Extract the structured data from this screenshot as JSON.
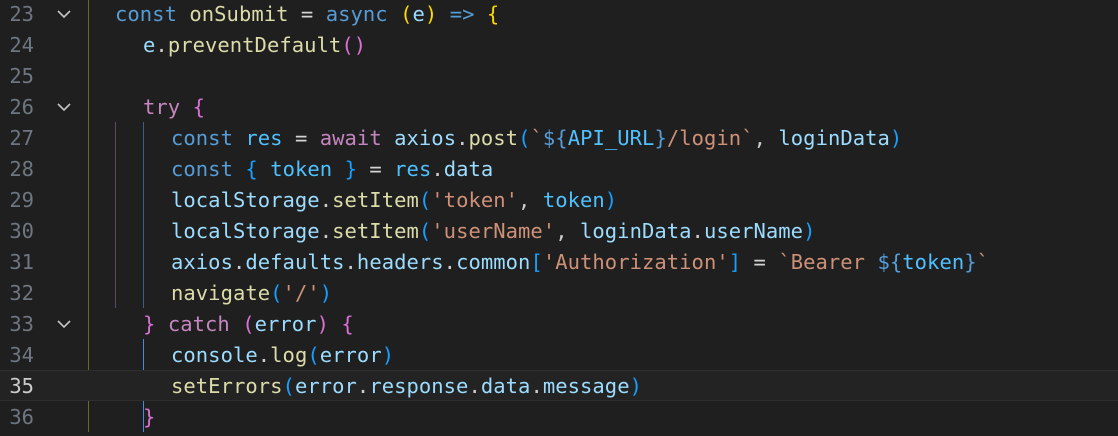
{
  "editor": {
    "lines": [
      {
        "num": "23",
        "fold": true,
        "indent": 1,
        "tokens": [
          {
            "t": "const",
            "c": "kw"
          },
          {
            "t": " ",
            "c": "punc"
          },
          {
            "t": "onSubmit",
            "c": "fnname"
          },
          {
            "t": " = ",
            "c": "op"
          },
          {
            "t": "async",
            "c": "kw"
          },
          {
            "t": " ",
            "c": "punc"
          },
          {
            "t": "(",
            "c": "b1"
          },
          {
            "t": "e",
            "c": "var"
          },
          {
            "t": ")",
            "c": "b1"
          },
          {
            "t": " => ",
            "c": "kw"
          },
          {
            "t": "{",
            "c": "b1"
          }
        ]
      },
      {
        "num": "24",
        "fold": false,
        "indent": 2,
        "tokens": [
          {
            "t": "e",
            "c": "var"
          },
          {
            "t": ".",
            "c": "punc"
          },
          {
            "t": "preventDefault",
            "c": "fnname"
          },
          {
            "t": "()",
            "c": "b2"
          }
        ]
      },
      {
        "num": "25",
        "fold": false,
        "indent": 2,
        "tokens": []
      },
      {
        "num": "26",
        "fold": true,
        "indent": 2,
        "tokens": [
          {
            "t": "try",
            "c": "ctrl"
          },
          {
            "t": " ",
            "c": "punc"
          },
          {
            "t": "{",
            "c": "b2"
          }
        ]
      },
      {
        "num": "27",
        "fold": false,
        "indent": 3,
        "tokens": [
          {
            "t": "const",
            "c": "kw"
          },
          {
            "t": " ",
            "c": "punc"
          },
          {
            "t": "res",
            "c": "const"
          },
          {
            "t": " = ",
            "c": "op"
          },
          {
            "t": "await",
            "c": "ctrl"
          },
          {
            "t": " ",
            "c": "punc"
          },
          {
            "t": "axios",
            "c": "var"
          },
          {
            "t": ".",
            "c": "punc"
          },
          {
            "t": "post",
            "c": "fnname"
          },
          {
            "t": "(",
            "c": "b3"
          },
          {
            "t": "`",
            "c": "str"
          },
          {
            "t": "${",
            "c": "kw"
          },
          {
            "t": "API_URL",
            "c": "const"
          },
          {
            "t": "}",
            "c": "kw"
          },
          {
            "t": "/login`",
            "c": "str"
          },
          {
            "t": ", ",
            "c": "punc"
          },
          {
            "t": "loginData",
            "c": "var"
          },
          {
            "t": ")",
            "c": "b3"
          }
        ]
      },
      {
        "num": "28",
        "fold": false,
        "indent": 3,
        "tokens": [
          {
            "t": "const",
            "c": "kw"
          },
          {
            "t": " ",
            "c": "punc"
          },
          {
            "t": "{",
            "c": "b3"
          },
          {
            "t": " ",
            "c": "punc"
          },
          {
            "t": "token",
            "c": "const"
          },
          {
            "t": " ",
            "c": "punc"
          },
          {
            "t": "}",
            "c": "b3"
          },
          {
            "t": " = ",
            "c": "op"
          },
          {
            "t": "res",
            "c": "const"
          },
          {
            "t": ".",
            "c": "punc"
          },
          {
            "t": "data",
            "c": "var"
          }
        ]
      },
      {
        "num": "29",
        "fold": false,
        "indent": 3,
        "tokens": [
          {
            "t": "localStorage",
            "c": "var"
          },
          {
            "t": ".",
            "c": "punc"
          },
          {
            "t": "setItem",
            "c": "fnname"
          },
          {
            "t": "(",
            "c": "b3"
          },
          {
            "t": "'token'",
            "c": "str"
          },
          {
            "t": ", ",
            "c": "punc"
          },
          {
            "t": "token",
            "c": "const"
          },
          {
            "t": ")",
            "c": "b3"
          }
        ]
      },
      {
        "num": "30",
        "fold": false,
        "indent": 3,
        "tokens": [
          {
            "t": "localStorage",
            "c": "var"
          },
          {
            "t": ".",
            "c": "punc"
          },
          {
            "t": "setItem",
            "c": "fnname"
          },
          {
            "t": "(",
            "c": "b3"
          },
          {
            "t": "'userName'",
            "c": "str"
          },
          {
            "t": ", ",
            "c": "punc"
          },
          {
            "t": "loginData",
            "c": "var"
          },
          {
            "t": ".",
            "c": "punc"
          },
          {
            "t": "userName",
            "c": "var"
          },
          {
            "t": ")",
            "c": "b3"
          }
        ]
      },
      {
        "num": "31",
        "fold": false,
        "indent": 3,
        "tokens": [
          {
            "t": "axios",
            "c": "var"
          },
          {
            "t": ".",
            "c": "punc"
          },
          {
            "t": "defaults",
            "c": "var"
          },
          {
            "t": ".",
            "c": "punc"
          },
          {
            "t": "headers",
            "c": "var"
          },
          {
            "t": ".",
            "c": "punc"
          },
          {
            "t": "common",
            "c": "var"
          },
          {
            "t": "[",
            "c": "b3"
          },
          {
            "t": "'Authorization'",
            "c": "str"
          },
          {
            "t": "]",
            "c": "b3"
          },
          {
            "t": " = ",
            "c": "op"
          },
          {
            "t": "`Bearer ",
            "c": "str"
          },
          {
            "t": "${",
            "c": "kw"
          },
          {
            "t": "token",
            "c": "const"
          },
          {
            "t": "}",
            "c": "kw"
          },
          {
            "t": "`",
            "c": "str"
          }
        ]
      },
      {
        "num": "32",
        "fold": false,
        "indent": 3,
        "tokens": [
          {
            "t": "navigate",
            "c": "fnname"
          },
          {
            "t": "(",
            "c": "b3"
          },
          {
            "t": "'/'",
            "c": "str"
          },
          {
            "t": ")",
            "c": "b3"
          }
        ]
      },
      {
        "num": "33",
        "fold": true,
        "indent": 2,
        "tokens": [
          {
            "t": "}",
            "c": "b2"
          },
          {
            "t": " ",
            "c": "punc"
          },
          {
            "t": "catch",
            "c": "ctrl"
          },
          {
            "t": " ",
            "c": "punc"
          },
          {
            "t": "(",
            "c": "b2"
          },
          {
            "t": "error",
            "c": "var"
          },
          {
            "t": ")",
            "c": "b2"
          },
          {
            "t": " ",
            "c": "punc"
          },
          {
            "t": "{",
            "c": "b2"
          }
        ]
      },
      {
        "num": "34",
        "fold": false,
        "indent": 3,
        "tokens": [
          {
            "t": "console",
            "c": "var"
          },
          {
            "t": ".",
            "c": "punc"
          },
          {
            "t": "log",
            "c": "fnname"
          },
          {
            "t": "(",
            "c": "b3"
          },
          {
            "t": "error",
            "c": "var"
          },
          {
            "t": ")",
            "c": "b3"
          }
        ]
      },
      {
        "num": "35",
        "fold": false,
        "indent": 3,
        "current": true,
        "tokens": [
          {
            "t": "setErrors",
            "c": "fnname"
          },
          {
            "t": "(",
            "c": "b3"
          },
          {
            "t": "error",
            "c": "var"
          },
          {
            "t": ".",
            "c": "punc"
          },
          {
            "t": "response",
            "c": "var"
          },
          {
            "t": ".",
            "c": "punc"
          },
          {
            "t": "data",
            "c": "var"
          },
          {
            "t": ".",
            "c": "punc"
          },
          {
            "t": "message",
            "c": "var"
          },
          {
            "t": ")",
            "c": "b3"
          }
        ]
      },
      {
        "num": "36",
        "fold": false,
        "indent": 2,
        "tokens": [
          {
            "t": "}",
            "c": "b2"
          }
        ]
      }
    ]
  },
  "theme": {
    "background": "#1f1f1f",
    "line_number": "#6e7681",
    "line_number_active": "#cccccc",
    "guide_outer": "#6b6b1f",
    "guide_try": "#5a4a66",
    "guide_inner": "#3b5f85",
    "guide_active": "#4a8ae0"
  }
}
